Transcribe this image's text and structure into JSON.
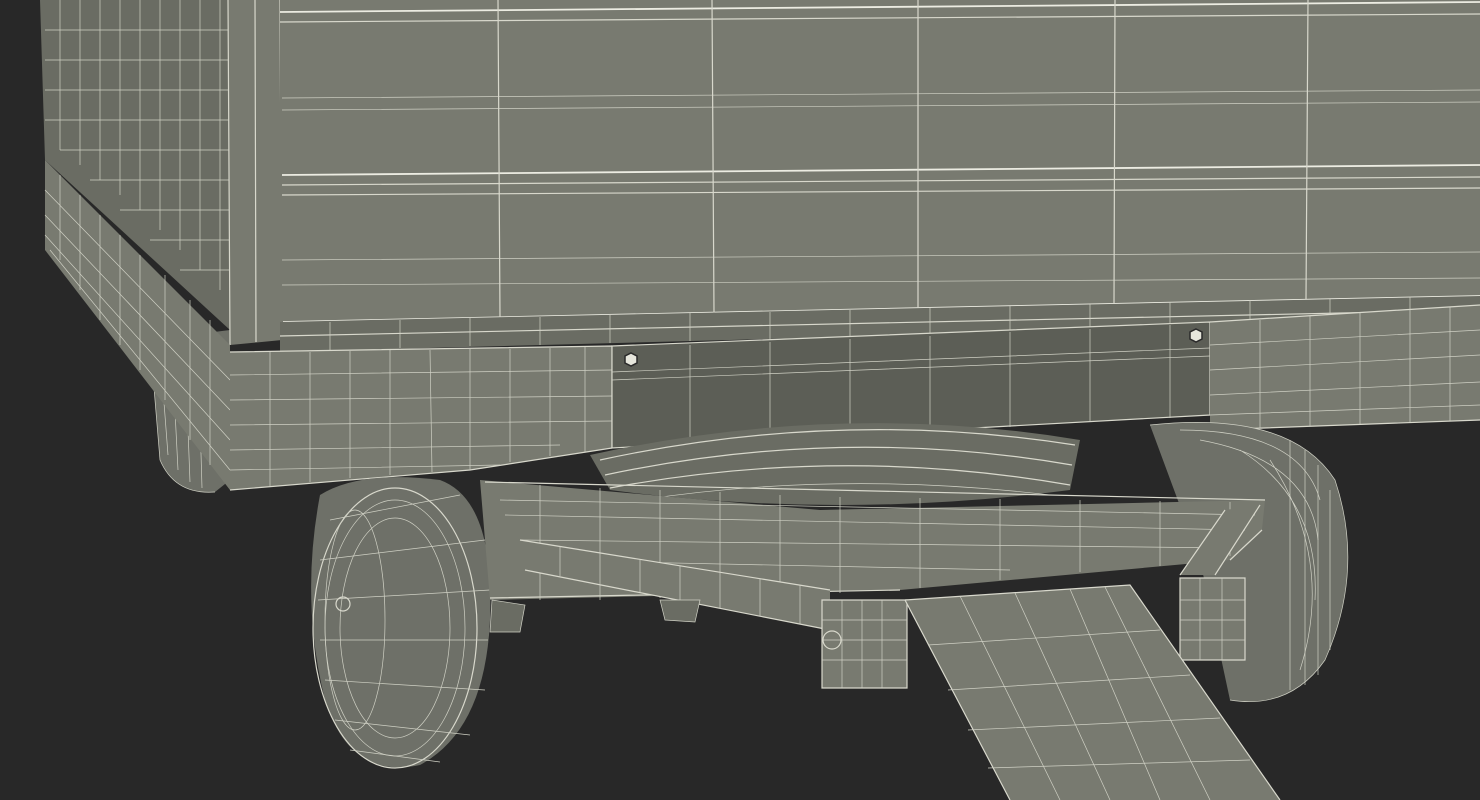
{
  "scene": {
    "subject": "",
    "colors": {
      "background": "#282828",
      "body": "#787a70",
      "wireframe": "#d8d8cc"
    }
  }
}
